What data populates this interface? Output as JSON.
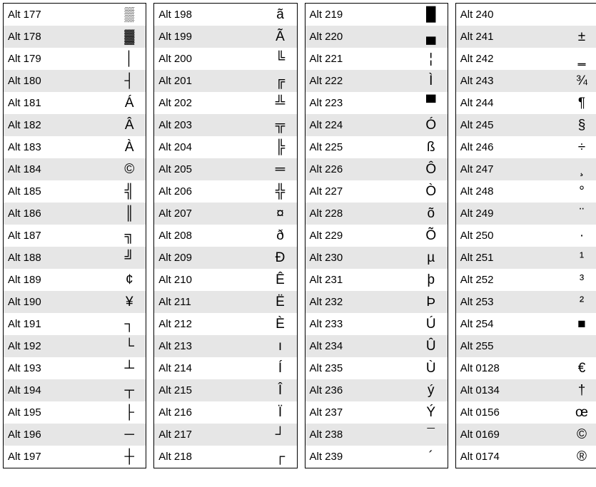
{
  "columns": [
    [
      {
        "code": "Alt 177",
        "sym": "▒"
      },
      {
        "code": "Alt 178",
        "sym": "▓"
      },
      {
        "code": "Alt 179",
        "sym": "│"
      },
      {
        "code": "Alt 180",
        "sym": "┤"
      },
      {
        "code": "Alt 181",
        "sym": "Á"
      },
      {
        "code": "Alt 182",
        "sym": "Â"
      },
      {
        "code": "Alt 183",
        "sym": "À"
      },
      {
        "code": "Alt 184",
        "sym": "©"
      },
      {
        "code": "Alt 185",
        "sym": "╣"
      },
      {
        "code": "Alt 186",
        "sym": "║"
      },
      {
        "code": "Alt 187",
        "sym": "╗"
      },
      {
        "code": "Alt 188",
        "sym": "╝"
      },
      {
        "code": "Alt 189",
        "sym": "¢"
      },
      {
        "code": "Alt 190",
        "sym": "¥"
      },
      {
        "code": "Alt 191",
        "sym": "┐"
      },
      {
        "code": "Alt 192",
        "sym": "└"
      },
      {
        "code": "Alt 193",
        "sym": "┴"
      },
      {
        "code": "Alt 194",
        "sym": "┬"
      },
      {
        "code": "Alt 195",
        "sym": "├"
      },
      {
        "code": "Alt 196",
        "sym": "─"
      },
      {
        "code": "Alt 197",
        "sym": "┼"
      }
    ],
    [
      {
        "code": "Alt 198",
        "sym": "ã"
      },
      {
        "code": "Alt 199",
        "sym": "Ã"
      },
      {
        "code": "Alt 200",
        "sym": "╚"
      },
      {
        "code": "Alt 201",
        "sym": "╔"
      },
      {
        "code": "Alt 202",
        "sym": "╩"
      },
      {
        "code": "Alt 203",
        "sym": "╦"
      },
      {
        "code": "Alt 204",
        "sym": "╠"
      },
      {
        "code": "Alt 205",
        "sym": "═"
      },
      {
        "code": "Alt 206",
        "sym": "╬"
      },
      {
        "code": "Alt 207",
        "sym": "¤"
      },
      {
        "code": "Alt 208",
        "sym": "ð"
      },
      {
        "code": "Alt 209",
        "sym": "Ð"
      },
      {
        "code": "Alt 210",
        "sym": "Ê"
      },
      {
        "code": "Alt 211",
        "sym": "Ë"
      },
      {
        "code": "Alt 212",
        "sym": "È"
      },
      {
        "code": "Alt 213",
        "sym": "ı"
      },
      {
        "code": "Alt 214",
        "sym": "Í"
      },
      {
        "code": "Alt 215",
        "sym": "Î"
      },
      {
        "code": "Alt 216",
        "sym": "Ï"
      },
      {
        "code": "Alt 217",
        "sym": "┘"
      },
      {
        "code": "Alt 218",
        "sym": "┌"
      }
    ],
    [
      {
        "code": "Alt 219",
        "sym": "█"
      },
      {
        "code": "Alt 220",
        "sym": "▄"
      },
      {
        "code": "Alt 221",
        "sym": "¦"
      },
      {
        "code": "Alt 222",
        "sym": "Ì"
      },
      {
        "code": "Alt 223",
        "sym": "▀"
      },
      {
        "code": "Alt 224",
        "sym": "Ó"
      },
      {
        "code": "Alt 225",
        "sym": "ß"
      },
      {
        "code": "Alt 226",
        "sym": "Ô"
      },
      {
        "code": "Alt 227",
        "sym": "Ò"
      },
      {
        "code": "Alt 228",
        "sym": "õ"
      },
      {
        "code": "Alt 229",
        "sym": "Õ"
      },
      {
        "code": "Alt 230",
        "sym": "µ"
      },
      {
        "code": "Alt 231",
        "sym": "þ"
      },
      {
        "code": "Alt 232",
        "sym": "Þ"
      },
      {
        "code": "Alt 233",
        "sym": "Ú"
      },
      {
        "code": "Alt 234",
        "sym": "Û"
      },
      {
        "code": "Alt 235",
        "sym": "Ù"
      },
      {
        "code": "Alt 236",
        "sym": "ý"
      },
      {
        "code": "Alt 237",
        "sym": "Ý"
      },
      {
        "code": "Alt 238",
        "sym": "¯"
      },
      {
        "code": "Alt 239",
        "sym": "´"
      }
    ],
    [
      {
        "code": "Alt 240",
        "sym": "­"
      },
      {
        "code": "Alt 241",
        "sym": "±"
      },
      {
        "code": "Alt 242",
        "sym": "‗"
      },
      {
        "code": "Alt 243",
        "sym": "¾"
      },
      {
        "code": "Alt 244",
        "sym": "¶"
      },
      {
        "code": "Alt 245",
        "sym": "§"
      },
      {
        "code": "Alt 246",
        "sym": "÷"
      },
      {
        "code": "Alt 247",
        "sym": "¸"
      },
      {
        "code": "Alt 248",
        "sym": "°"
      },
      {
        "code": "Alt 249",
        "sym": "¨"
      },
      {
        "code": "Alt 250",
        "sym": "·"
      },
      {
        "code": "Alt 251",
        "sym": "¹"
      },
      {
        "code": "Alt 252",
        "sym": "³"
      },
      {
        "code": "Alt 253",
        "sym": "²"
      },
      {
        "code": "Alt 254",
        "sym": "■"
      },
      {
        "code": "Alt 255",
        "sym": " "
      },
      {
        "code": "Alt 0128",
        "sym": "€"
      },
      {
        "code": "Alt 0134",
        "sym": "†"
      },
      {
        "code": "Alt 0156",
        "sym": "œ"
      },
      {
        "code": "Alt 0169",
        "sym": "©"
      },
      {
        "code": "Alt 0174",
        "sym": "®"
      }
    ]
  ]
}
